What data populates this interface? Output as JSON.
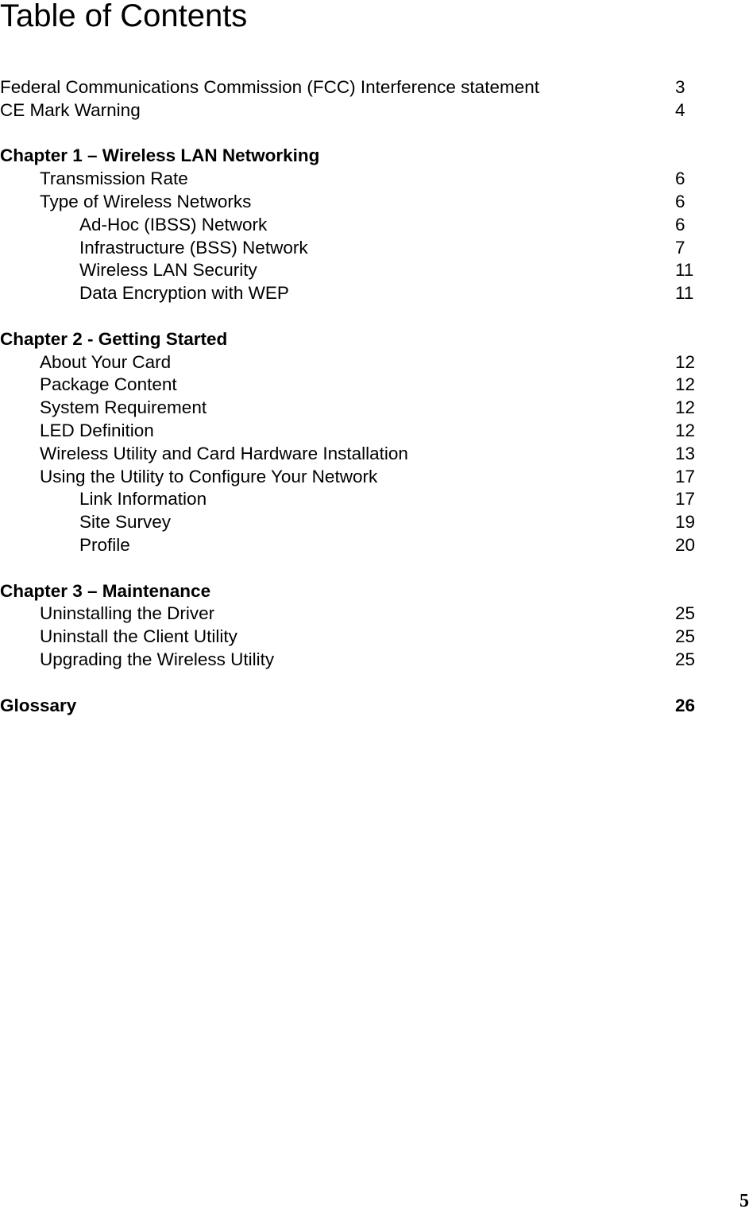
{
  "title": "Table of Contents",
  "entries": [
    {
      "label": "Federal Communications Commission (FCC) Interference statement",
      "page": "3",
      "level": 0,
      "bold": false
    },
    {
      "label": "CE Mark Warning",
      "page": "4",
      "level": 0,
      "bold": false
    },
    {
      "gap": true
    },
    {
      "label": "Chapter 1 – Wireless LAN Networking",
      "page": "",
      "level": 0,
      "bold": true
    },
    {
      "label": "Transmission Rate",
      "page": "6",
      "level": 1,
      "bold": false
    },
    {
      "label": "Type of Wireless Networks",
      "page": "6",
      "level": 1,
      "bold": false
    },
    {
      "label": "Ad-Hoc (IBSS) Network",
      "page": "6",
      "level": 2,
      "bold": false
    },
    {
      "label": "Infrastructure (BSS) Network",
      "page": "7",
      "level": 2,
      "bold": false
    },
    {
      "label": "Wireless LAN Security",
      "page": "11",
      "level": 2,
      "bold": false
    },
    {
      "label": "Data Encryption with WEP",
      "page": "11",
      "level": 2,
      "bold": false
    },
    {
      "gap": true
    },
    {
      "label": "Chapter 2 - Getting Started",
      "page": "",
      "level": 0,
      "bold": true
    },
    {
      "label": "About Your Card",
      "page": "12",
      "level": 1,
      "bold": false
    },
    {
      "label": "Package Content",
      "page": "12",
      "level": 1,
      "bold": false
    },
    {
      "label": "System Requirement",
      "page": "12",
      "level": 1,
      "bold": false
    },
    {
      "label": "LED Definition",
      "page": "12",
      "level": 1,
      "bold": false
    },
    {
      "label": "Wireless Utility and Card Hardware Installation",
      "page": "13",
      "level": 1,
      "bold": false
    },
    {
      "label": "Using the Utility to Configure Your Network",
      "page": "17",
      "level": 1,
      "bold": false
    },
    {
      "label": "Link Information",
      "page": "17",
      "level": 2,
      "bold": false
    },
    {
      "label": "Site Survey",
      "page": "19",
      "level": 2,
      "bold": false
    },
    {
      "label": "Profile",
      "page": "20",
      "level": 2,
      "bold": false
    },
    {
      "gap": true
    },
    {
      "label": "Chapter 3 – Maintenance",
      "page": "",
      "level": 0,
      "bold": true
    },
    {
      "label": "Uninstalling the Driver",
      "page": "25",
      "level": 1,
      "bold": false
    },
    {
      "label": "Uninstall the Client Utility",
      "page": "25",
      "level": 1,
      "bold": false
    },
    {
      "label": "Upgrading the Wireless Utility",
      "page": "25",
      "level": 1,
      "bold": false
    },
    {
      "gap": true
    },
    {
      "label": "Glossary",
      "page": "26",
      "level": 0,
      "bold": true
    }
  ],
  "page_number": "5"
}
